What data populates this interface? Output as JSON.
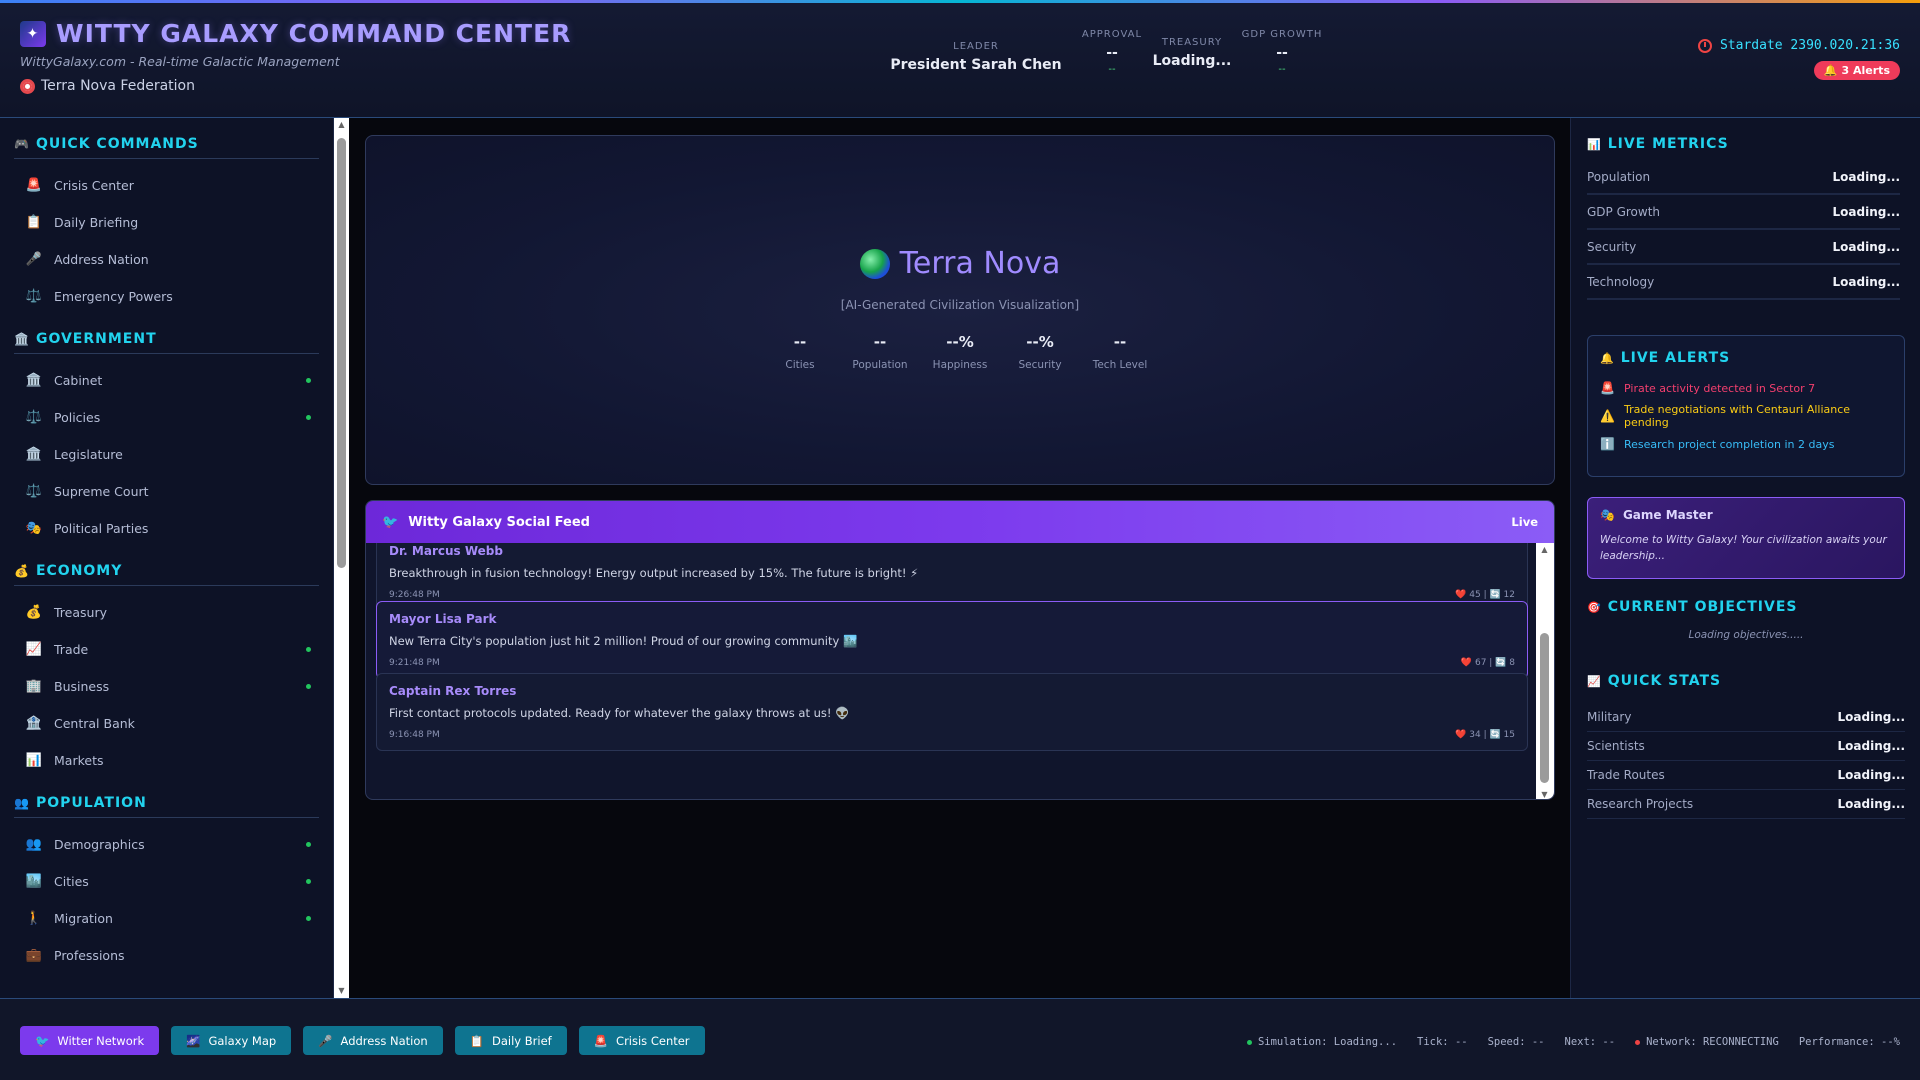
{
  "header": {
    "title": "WITTY GALAXY COMMAND CENTER",
    "subtitle": "WittyGalaxy.com - Real-time Galactic Management",
    "nation": "Terra Nova Federation",
    "leader_label": "LEADER",
    "leader_value": "President Sarah Chen",
    "approval_label": "APPROVAL",
    "approval_value": "--",
    "approval_sub": "--",
    "treasury_label": "TREASURY",
    "treasury_value": "Loading...",
    "gdp_label": "GDP GROWTH",
    "gdp_value": "--",
    "gdp_sub": "--",
    "stardate": "Stardate 2390.020.21:36",
    "alerts_badge": "3 Alerts"
  },
  "sidebar": {
    "sections": [
      {
        "title": "QUICK COMMANDS",
        "icon": "gamepad-icon",
        "items": [
          {
            "label": "Crisis Center",
            "icon": "siren-icon",
            "dot": false
          },
          {
            "label": "Daily Briefing",
            "icon": "clipboard-icon",
            "dot": false
          },
          {
            "label": "Address Nation",
            "icon": "microphone-icon",
            "dot": false
          },
          {
            "label": "Emergency Powers",
            "icon": "scales-icon",
            "dot": false
          }
        ]
      },
      {
        "title": "GOVERNMENT",
        "icon": "government-icon",
        "items": [
          {
            "label": "Cabinet",
            "icon": "government-icon",
            "dot": true
          },
          {
            "label": "Policies",
            "icon": "scales-icon",
            "dot": true
          },
          {
            "label": "Legislature",
            "icon": "government-icon",
            "dot": false
          },
          {
            "label": "Supreme Court",
            "icon": "scales-icon",
            "dot": false
          },
          {
            "label": "Political Parties",
            "icon": "masks-icon",
            "dot": false
          }
        ]
      },
      {
        "title": "ECONOMY",
        "icon": "money-bag-icon",
        "items": [
          {
            "label": "Treasury",
            "icon": "money-bag-icon",
            "dot": false
          },
          {
            "label": "Trade",
            "icon": "chart-up-icon",
            "dot": true
          },
          {
            "label": "Business",
            "icon": "office-icon",
            "dot": true
          },
          {
            "label": "Central Bank",
            "icon": "bank-icon",
            "dot": false
          },
          {
            "label": "Markets",
            "icon": "bar-chart-icon",
            "dot": false
          }
        ]
      },
      {
        "title": "POPULATION",
        "icon": "people-icon",
        "items": [
          {
            "label": "Demographics",
            "icon": "people-icon",
            "dot": true
          },
          {
            "label": "Cities",
            "icon": "city-icon",
            "dot": true
          },
          {
            "label": "Migration",
            "icon": "walking-icon",
            "dot": true
          },
          {
            "label": "Professions",
            "icon": "briefcase-icon",
            "dot": false
          }
        ]
      }
    ]
  },
  "visualization": {
    "title": "Terra Nova",
    "subtitle": "[AI-Generated Civilization Visualization]",
    "stats": [
      {
        "value": "--",
        "label": "Cities"
      },
      {
        "value": "--",
        "label": "Population"
      },
      {
        "value": "--%",
        "label": "Happiness"
      },
      {
        "value": "--%",
        "label": "Security"
      },
      {
        "value": "--",
        "label": "Tech Level"
      }
    ]
  },
  "feed": {
    "title": "Witty Galaxy Social Feed",
    "live_label": "Live",
    "posts": [
      {
        "author": "Dr. Marcus Webb",
        "text": "Breakthrough in fusion technology! Energy output increased by 15%. The future is bright! ⚡",
        "time": "9:26:48 PM",
        "likes": "45",
        "reposts": "12",
        "active": false
      },
      {
        "author": "Mayor Lisa Park",
        "text": "New Terra City's population just hit 2 million! Proud of our growing community 🏙️",
        "time": "9:21:48 PM",
        "likes": "67",
        "reposts": "8",
        "active": true
      },
      {
        "author": "Captain Rex Torres",
        "text": "First contact protocols updated. Ready for whatever the galaxy throws at us! 👽",
        "time": "9:16:48 PM",
        "likes": "34",
        "reposts": "15",
        "active": false
      }
    ]
  },
  "right_panel": {
    "live_metrics_title": "LIVE METRICS",
    "metrics": [
      {
        "name": "Population",
        "value": "Loading..."
      },
      {
        "name": "GDP Growth",
        "value": "Loading..."
      },
      {
        "name": "Security",
        "value": "Loading..."
      },
      {
        "name": "Technology",
        "value": "Loading..."
      }
    ],
    "live_alerts_title": "LIVE ALERTS",
    "alerts": [
      {
        "icon": "siren-icon",
        "text": "Pirate activity detected in Sector 7",
        "color": "#f43f6e"
      },
      {
        "icon": "warning-icon",
        "text": "Trade negotiations with Centauri Alliance pending",
        "color": "#facc15"
      },
      {
        "icon": "info-icon",
        "text": "Research project completion in 2 days",
        "color": "#38bdf8"
      }
    ],
    "game_master_title": "Game Master",
    "game_master_text": "Welcome to Witty Galaxy! Your civilization awaits your leadership...",
    "objectives_title": "CURRENT OBJECTIVES",
    "objectives_text": "Loading objectives.....",
    "quick_stats_title": "QUICK STATS",
    "quick_stats": [
      {
        "name": "Military",
        "value": "Loading..."
      },
      {
        "name": "Scientists",
        "value": "Loading..."
      },
      {
        "name": "Trade Routes",
        "value": "Loading..."
      },
      {
        "name": "Research Projects",
        "value": "Loading..."
      }
    ]
  },
  "bottom_bar": {
    "buttons": [
      {
        "label": "Witter Network",
        "icon": "bird-icon",
        "primary": true
      },
      {
        "label": "Galaxy Map",
        "icon": "galaxy-icon",
        "primary": false
      },
      {
        "label": "Address Nation",
        "icon": "microphone-icon",
        "primary": false
      },
      {
        "label": "Daily Brief",
        "icon": "clipboard-icon",
        "primary": false
      },
      {
        "label": "Crisis Center",
        "icon": "siren-icon",
        "primary": false
      }
    ],
    "status": {
      "simulation": "Simulation: Loading...",
      "tick": "Tick: --",
      "speed": "Speed: --",
      "next": "Next: --",
      "network": "Network: RECONNECTING",
      "performance": "Performance: --%"
    },
    "colors": {
      "ok": "#22c55e",
      "error": "#ef4444"
    }
  }
}
